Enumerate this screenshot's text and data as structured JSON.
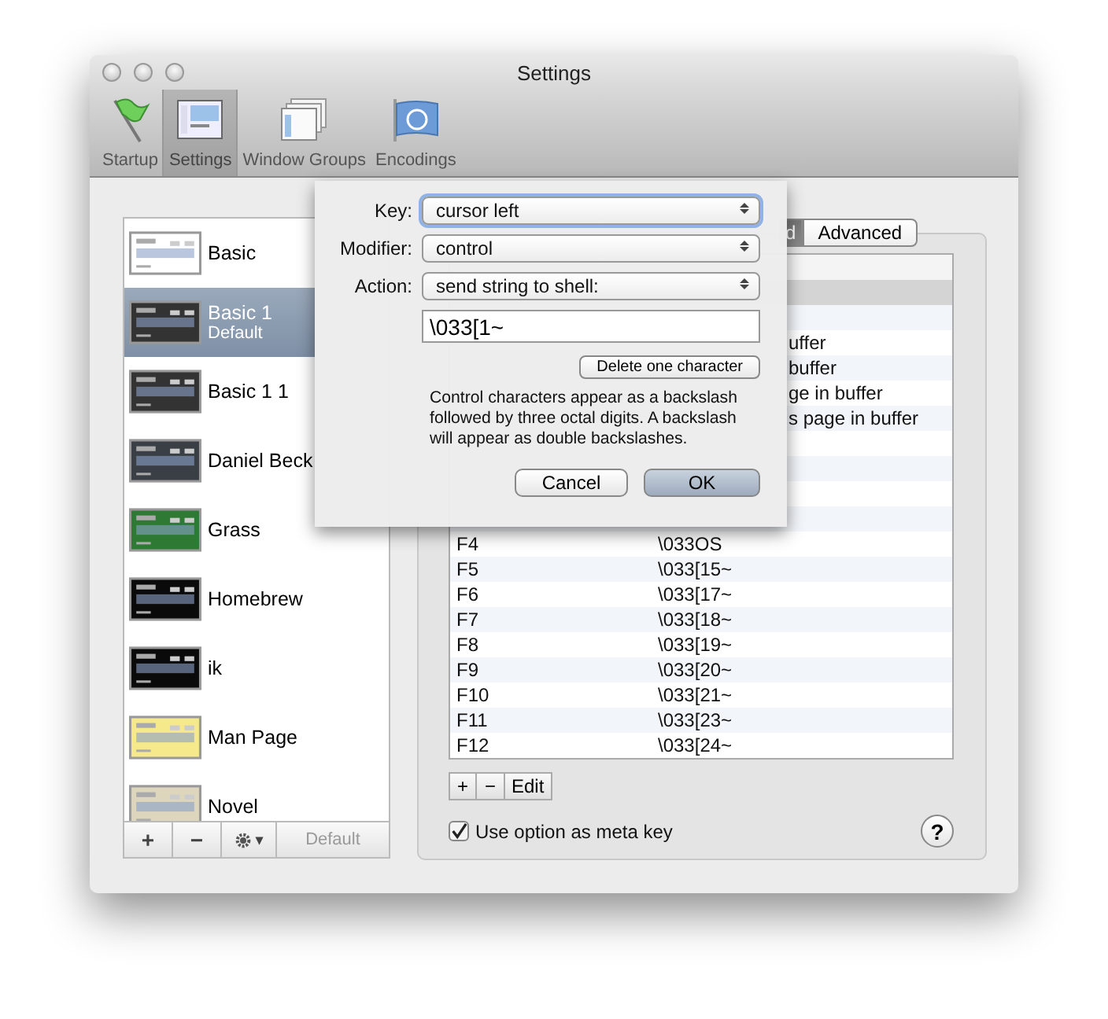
{
  "window": {
    "title": "Settings"
  },
  "toolbar": [
    {
      "label": "Startup",
      "kind": "flag",
      "selected": false
    },
    {
      "label": "Settings",
      "kind": "settings",
      "selected": true
    },
    {
      "label": "Window Groups",
      "kind": "windows",
      "selected": false
    },
    {
      "label": "Encodings",
      "kind": "globe",
      "selected": false
    }
  ],
  "profiles": [
    {
      "name": "Basic",
      "selected": false,
      "kind": "light"
    },
    {
      "name": "Basic 1",
      "subtitle": "Default",
      "selected": true,
      "kind": "dark"
    },
    {
      "name": "Basic 1 1",
      "selected": false,
      "kind": "dark"
    },
    {
      "name": "Daniel Beck",
      "selected": false,
      "kind": "slate"
    },
    {
      "name": "Grass",
      "selected": false,
      "kind": "grass"
    },
    {
      "name": "Homebrew",
      "selected": false,
      "kind": "black"
    },
    {
      "name": "ik",
      "selected": false,
      "kind": "black"
    },
    {
      "name": "Man Page",
      "selected": false,
      "kind": "yellow"
    },
    {
      "name": "Novel",
      "selected": false,
      "kind": "beige"
    }
  ],
  "profile_buttons": {
    "add": "+",
    "remove": "−",
    "gear_caret": "▾",
    "default": "Default",
    "default_disabled": true
  },
  "tabs": [
    {
      "label": "d",
      "selected": true
    },
    {
      "label": "Advanced",
      "selected": false
    }
  ],
  "table": {
    "rows": [
      {
        "selected": true
      },
      {
        "selected": false
      },
      {
        "action": "uffer",
        "selected": false
      },
      {
        "action": "buffer",
        "selected": false
      },
      {
        "action": "ge in buffer",
        "selected": false
      },
      {
        "action": "s page in buffer",
        "selected": false
      },
      {
        "selected": false
      },
      {
        "selected": false
      },
      {
        "selected": false
      },
      {
        "selected": false
      },
      {
        "key": "F4",
        "action": "\\033OS",
        "selected": false
      },
      {
        "key": "F5",
        "action": "\\033[15~",
        "selected": false
      },
      {
        "key": "F6",
        "action": "\\033[17~",
        "selected": false
      },
      {
        "key": "F7",
        "action": "\\033[18~",
        "selected": false
      },
      {
        "key": "F8",
        "action": "\\033[19~",
        "selected": false
      },
      {
        "key": "F9",
        "action": "\\033[20~",
        "selected": false
      },
      {
        "key": "F10",
        "action": "\\033[21~",
        "selected": false
      },
      {
        "key": "F11",
        "action": "\\033[23~",
        "selected": false
      },
      {
        "key": "F12",
        "action": "\\033[24~",
        "selected": false
      }
    ]
  },
  "table_buttons": {
    "add": "+",
    "remove": "−",
    "edit": "Edit"
  },
  "meta_key": {
    "label": "Use option as meta key",
    "checked": true
  },
  "help": "?",
  "sheet": {
    "key_label": "Key:",
    "key": "cursor left",
    "modifier_label": "Modifier:",
    "modifier": "control",
    "action_label": "Action:",
    "action": "send string to shell:",
    "string": "\\033[1~",
    "delete_button": "Delete one character",
    "note": "Control characters appear as a backslash followed by three octal digits.  A backslash will appear as double backslashes.",
    "cancel": "Cancel",
    "ok": "OK"
  }
}
